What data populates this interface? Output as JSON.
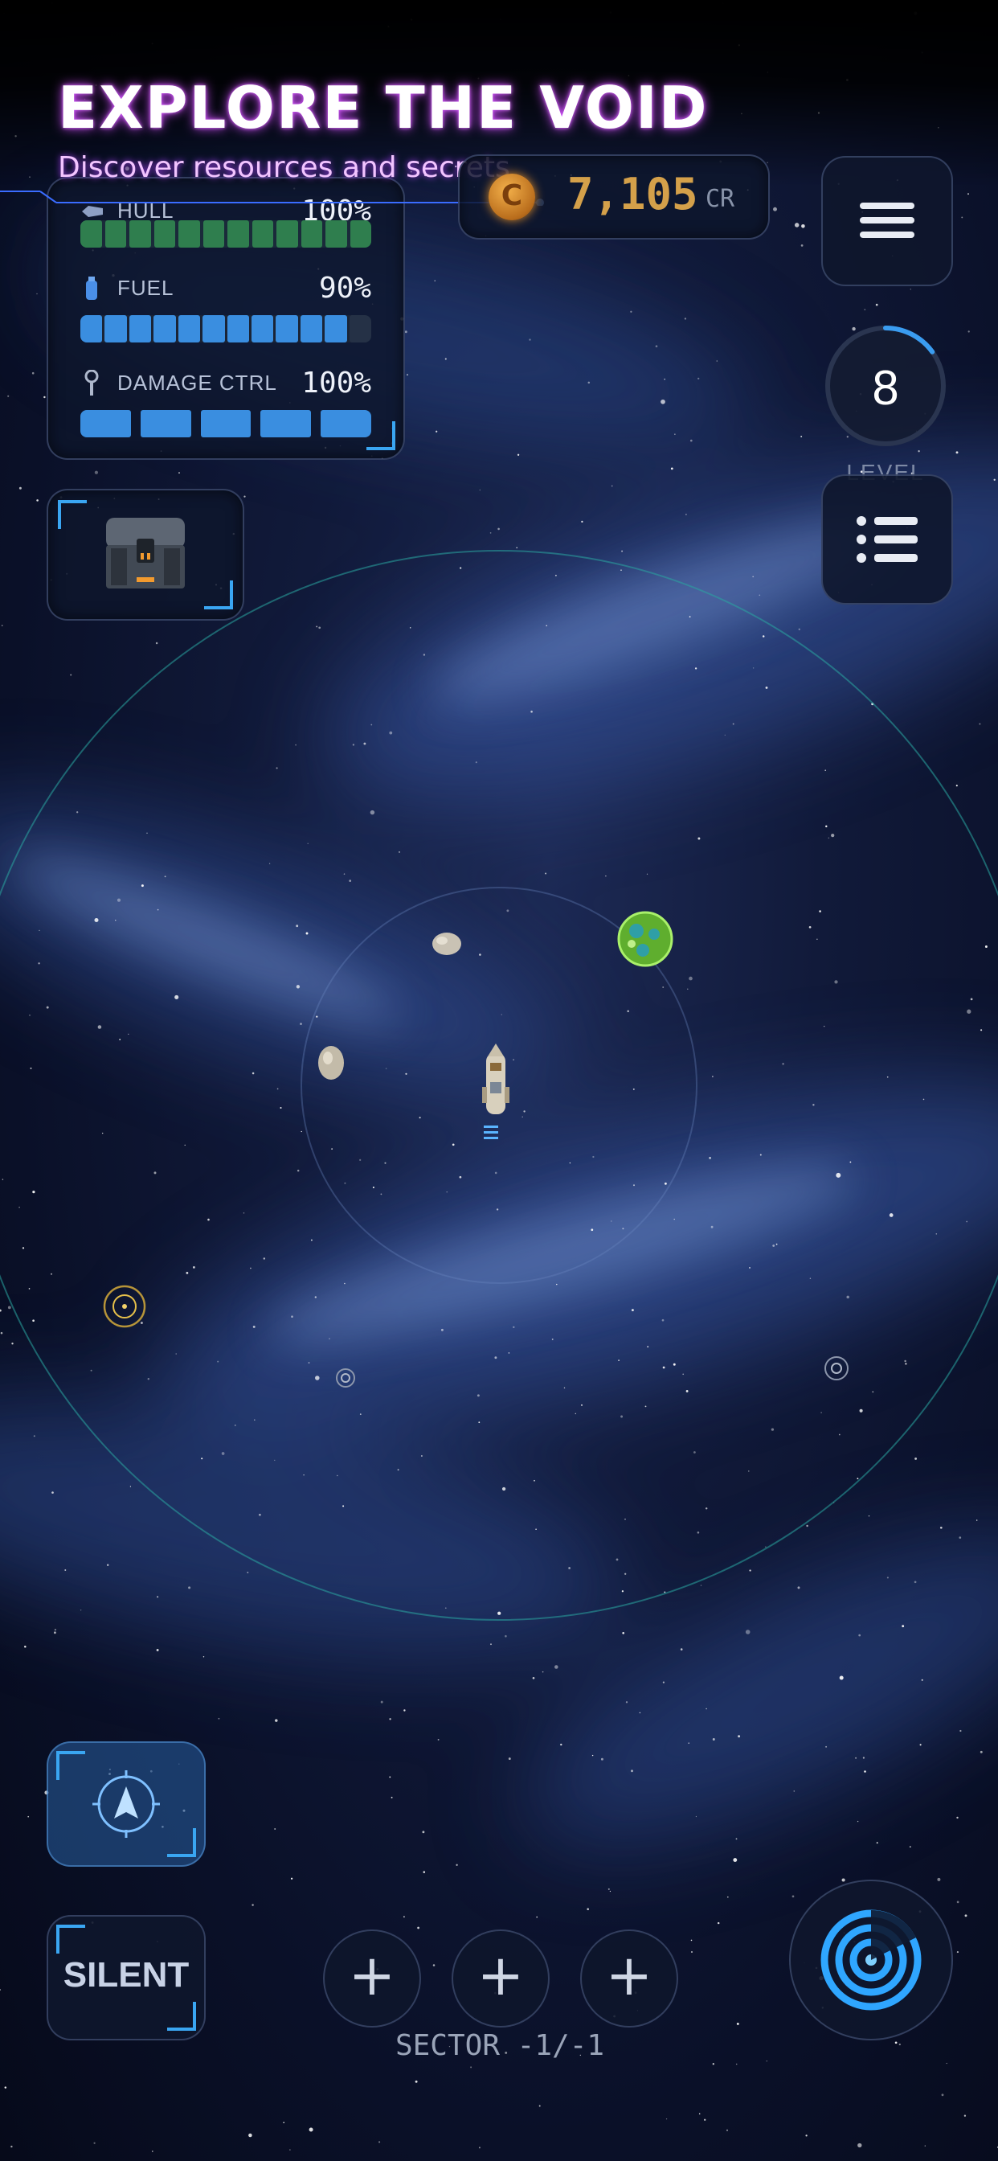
{
  "header": {
    "title": "EXPLORE THE VOID",
    "subtitle": "Discover resources and secrets"
  },
  "stats": {
    "hull": {
      "label": "HULL",
      "value": "100%",
      "level": 1.0,
      "color": "#2f7e4e"
    },
    "fuel": {
      "label": "FUEL",
      "value": "90%",
      "level": 0.9,
      "color": "#3a8ee0"
    },
    "damage_ctrl": {
      "label": "DAMAGE CTRL",
      "value": "100%",
      "level": 1.0,
      "color": "#3a8ee0"
    }
  },
  "credits": {
    "symbol": "C",
    "value": "7,105",
    "unit": "CR"
  },
  "level": {
    "value": "8",
    "label": "LEVEL",
    "progress": 0.15
  },
  "controls": {
    "silent_label": "SILENT",
    "plus_label": "+"
  },
  "sector": {
    "label": "SECTOR -1/-1"
  },
  "icons": {
    "menu": "hamburger-icon",
    "list": "list-icon",
    "chest": "treasure-chest-icon",
    "navigate": "compass-icon",
    "scan": "radar-scan-icon",
    "hull": "hull-icon",
    "fuel": "fuel-icon",
    "damage": "wrench-icon"
  },
  "colors": {
    "title_glow": "#d24dff",
    "accent": "#3aa6f2",
    "credits": "#d4a04a",
    "radar_ring": "#2aa6a0"
  }
}
